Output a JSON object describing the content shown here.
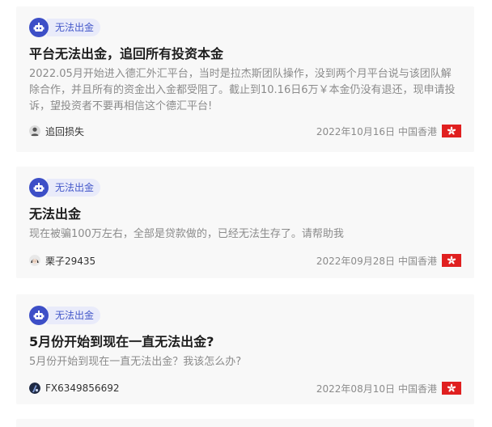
{
  "complaints": [
    {
      "tag": "无法出金",
      "title": "平台无法出金，追回所有投资本金",
      "description": "2022.05月开始进入德汇外汇平台，当时是拉杰斯团队操作，没到两个月平台说与该团队解除合作，并且所有的资金出入金都受阻了。截止到10.16日6万￥本金仍没有退还，现申请投诉，望投资者不要再相信这个德汇平台!",
      "user": "追回损失",
      "avatar_icon": "person-silhouette-icon",
      "date": "2022年10月16日",
      "region": "中国香港",
      "flag_icon": "hong-kong-flag-icon"
    },
    {
      "tag": "无法出金",
      "title": "无法出金",
      "description": "现在被骗100万左右，全部是贷款做的，已经无法生存了。请帮助我",
      "user": "栗子29435",
      "avatar_icon": "girl-avatar-icon",
      "date": "2022年09月28日",
      "region": "中国香港",
      "flag_icon": "hong-kong-flag-icon"
    },
    {
      "tag": "无法出金",
      "title": "5月份开始到现在一直无法出金?",
      "description": "5月份开始到现在一直无法出金？我该怎么办?",
      "user": "FX6349856692",
      "avatar_icon": "dark-avatar-icon",
      "date": "2022年08月10日",
      "region": "中国香港",
      "flag_icon": "hong-kong-flag-icon"
    }
  ],
  "colors": {
    "accent": "#3d4fc7",
    "tag_bg": "#e9ebfa",
    "card_bg": "#f8f8f8",
    "flag_red": "#e02020"
  }
}
